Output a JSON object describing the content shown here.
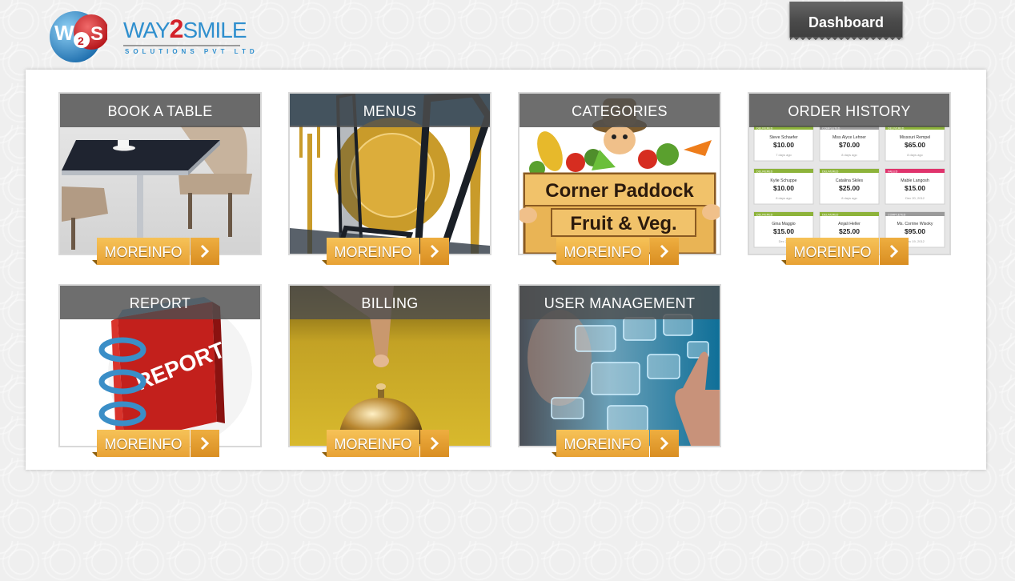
{
  "header": {
    "logo": {
      "mark": "W2S",
      "word_prefix": "WAY",
      "word_two": "2",
      "word_suffix": "SMILE",
      "tagline": "SOLUTIONS PVT LTD"
    },
    "dashboard_label": "Dashboard"
  },
  "tiles": [
    {
      "title": "BOOK A TABLE",
      "more": "MOREINFO"
    },
    {
      "title": "MENUS",
      "more": "MOREINFO"
    },
    {
      "title": "CATEGORIES",
      "more": "MOREINFO"
    },
    {
      "title": "ORDER HISTORY",
      "more": "MOREINFO"
    },
    {
      "title": "REPORT",
      "more": "MOREINFO"
    },
    {
      "title": "BILLING",
      "more": "MOREINFO"
    },
    {
      "title": "USER MANAGEMENT",
      "more": "MOREINFO"
    }
  ],
  "images": {
    "categories_sign": [
      "Corner Paddock",
      "Fruit & Veg."
    ],
    "report_cover": "REPORT",
    "order_cards": [
      {
        "status": "DELIVERED",
        "name": "Steve Schaefer",
        "amount": "$10.00",
        "ago": "7 days ago"
      },
      {
        "status": "COMPLETED",
        "name": "Miss Alyce Lehner",
        "amount": "$70.00",
        "ago": "8 days ago"
      },
      {
        "status": "DELIVERED",
        "name": "Missouri Rempel",
        "amount": "$65.00",
        "ago": "8 days ago"
      },
      {
        "status": "DELIVERED",
        "name": "Kylie Schuppe",
        "amount": "$10.00",
        "ago": "8 days ago"
      },
      {
        "status": "DELIVERED",
        "name": "Catalina Skiles",
        "amount": "$25.00",
        "ago": "8 days ago"
      },
      {
        "status": "FAILED",
        "name": "Mable Langosh",
        "amount": "$15.00",
        "ago": "Dec 20, 2012"
      },
      {
        "status": "DELIVERED",
        "name": "Gina Maggio",
        "amount": "$15.00",
        "ago": "Dec 21"
      },
      {
        "status": "DELIVERED",
        "name": "Anjali Heller",
        "amount": "$25.00",
        "ago": ""
      },
      {
        "status": "COMPLETED",
        "name": "Ms. Corrine Wisoky",
        "amount": "$95.00",
        "ago": "Dec 19, 2012"
      }
    ]
  },
  "colors": {
    "accent_orange": "#e8a235",
    "title_band": "#4e4e4e",
    "status_delivered": "#8db33a",
    "status_completed": "#9a9a9a",
    "status_failed": "#e0336c"
  },
  "icons": {
    "more_arrow": "chevron-right-icon",
    "dashboard": "none"
  }
}
